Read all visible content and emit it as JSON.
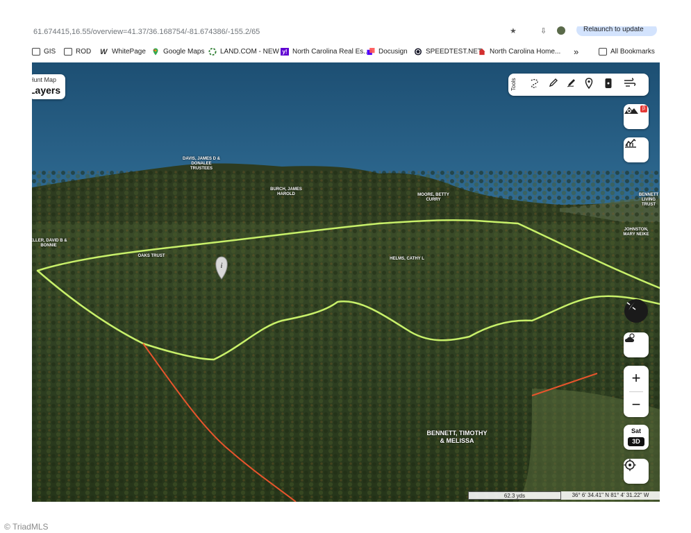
{
  "browser": {
    "url_text": "61.674415,16.55/overview=41.37/36.168754/-81.674386/-155.2/65",
    "relaunch_label": "Relaunch to update",
    "bookmarks": [
      {
        "label": "GIS",
        "icon": "folder-icon"
      },
      {
        "label": "ROD",
        "icon": "folder-icon"
      },
      {
        "label": "WhitePage",
        "icon": "whitepage-icon"
      },
      {
        "label": "Google Maps",
        "icon": "google-maps-icon"
      },
      {
        "label": "LAND.COM - NEW",
        "icon": "land-icon"
      },
      {
        "label": "North Carolina Real Es...",
        "icon": "yahoo-icon"
      },
      {
        "label": "Docusign",
        "icon": "docusign-icon"
      },
      {
        "label": "SPEEDTEST.NET",
        "icon": "speedtest-icon"
      },
      {
        "label": "North Carolina Home...",
        "icon": "home-icon"
      }
    ],
    "more_label": "»",
    "all_bookmarks_label": "All Bookmarks"
  },
  "map": {
    "layers_small": "Hunt Map",
    "layers_big": "Layers",
    "tools_label": "Tools",
    "tools": [
      "lasso-icon",
      "pencil-icon",
      "draw-icon",
      "pin-icon",
      "device-icon",
      "wind-icon"
    ],
    "beta_badge": "β",
    "owners": {
      "davis": "DAVIS, JAMES D & DONALEE TRUSTEES",
      "burch": "BURCH, JAMES HAROLD",
      "moore": "MOORE, BETTY CURRY",
      "bennett_living": "BENNETT LIVING TRUST",
      "johnston": "JOHNSTON, MARY NEIKE",
      "eller": "ELLER, DAVID B & BONNIE",
      "oaks": "OAKS TRUST",
      "helms": "HELMS, CATHY L",
      "bennett": "BENNETT, TIMOTHY & MELISSA"
    },
    "sat_label": "Sat",
    "d3_label": "3D",
    "zoom_in": "+",
    "zoom_out": "−",
    "scale": "62.3 yds",
    "coords": "36° 6' 34.41\" N 81° 4' 31.22\" W",
    "info_glyph": "i",
    "colors": {
      "boundary": "#c8f06a",
      "road": "#e8542c"
    }
  },
  "footer": {
    "watermark": "© TriadMLS"
  }
}
